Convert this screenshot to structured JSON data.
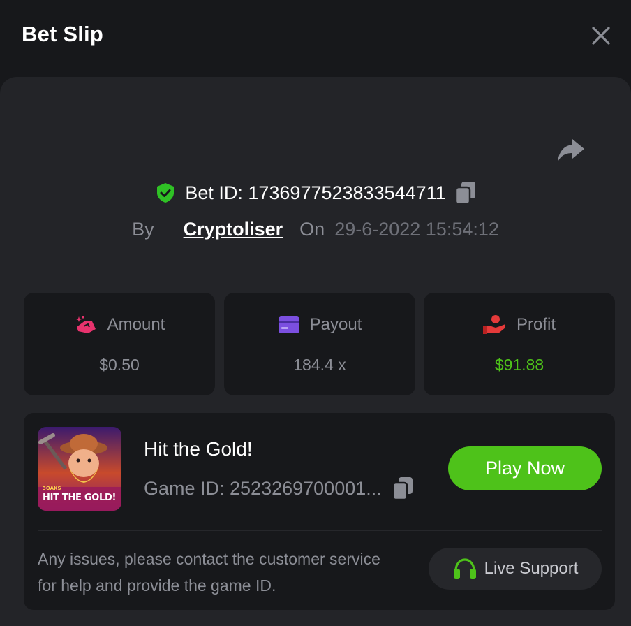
{
  "header": {
    "title": "Bet Slip",
    "close_icon": "close-icon"
  },
  "bet": {
    "share_icon": "share-icon",
    "verified_icon": "shield-check-icon",
    "bet_id_text": "Bet ID: 1736977523833544711",
    "copy_icon": "copy-icon",
    "by_label": "By",
    "user": "Cryptoliser",
    "on_label": "On",
    "date": "29-6-2022 15:54:12"
  },
  "stats": [
    {
      "label": "Amount",
      "value": "$0.50",
      "icon": "amount-icon",
      "icon_color": "#e8336e"
    },
    {
      "label": "Payout",
      "value": "184.4 x",
      "icon": "card-icon",
      "icon_color": "#7b4fe0"
    },
    {
      "label": "Profit",
      "value": "$91.88",
      "icon": "profit-hand-icon",
      "icon_color": "#e53a3a",
      "value_color": "#4ec21a"
    }
  ],
  "game": {
    "name": "Hit the Gold!",
    "game_id_text": "Game ID: 2523269700001...",
    "thumb_text": "HIT THE GOLD!",
    "thumb_brand": "3OAKS",
    "play_label": "Play Now",
    "notice": "Any issues, please contact the customer service for help and provide the game ID.",
    "support_label": "Live Support",
    "support_icon": "headset-icon"
  },
  "colors": {
    "background": "#17181b",
    "panel": "#232428",
    "accent_green": "#4ec21a",
    "muted_text": "#8c8e96"
  }
}
